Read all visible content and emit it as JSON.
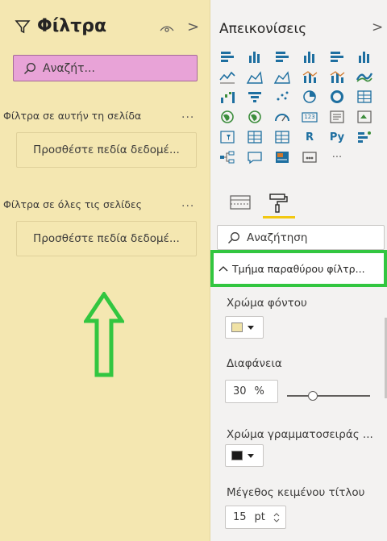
{
  "filters": {
    "title": "Φίλτρα",
    "search_placeholder": "Αναζήτ...",
    "page_section": "Φίλτρα σε αυτήν τη σελίδα",
    "page_dots": "...",
    "page_drop": "Προσθέστε πεδία δεδομέ...",
    "all_section": "Φίλτρα σε όλες τις σελίδες",
    "all_dots": "...",
    "all_drop": "Προσθέστε πεδία δεδομέ..."
  },
  "viz": {
    "title": "Απεικονίσεις",
    "icons": [
      "stacked-bar-chart-icon",
      "stacked-column-chart-icon",
      "clustered-bar-chart-icon",
      "clustered-column-chart-icon",
      "100-percent-bar-chart-icon",
      "100-percent-column-chart-icon",
      "line-chart-icon",
      "area-chart-icon",
      "stacked-area-chart-icon",
      "line-and-column-chart-icon",
      "line-and-clustered-column-chart-icon",
      "ribbon-chart-icon",
      "waterfall-chart-icon",
      "funnel-chart-icon",
      "scatter-chart-icon",
      "pie-chart-icon",
      "donut-chart-icon",
      "treemap-icon",
      "map-icon",
      "filled-map-icon",
      "gauge-icon",
      "card-icon",
      "multi-row-card-icon",
      "kpi-icon",
      "slicer-icon",
      "table-icon",
      "matrix-icon",
      "r-visual-icon",
      "python-visual-icon",
      "key-influencers-icon",
      "decomposition-tree-icon",
      "qa-icon",
      "smart-narrative-icon",
      "paginated-report-icon",
      "more-visuals-icon"
    ],
    "icon_text": {
      "r": "R",
      "py": "Py",
      "more": "···",
      "card": "123"
    },
    "search_placeholder": "Αναζήτηση",
    "section_title": "Τμήμα παραθύρου φίλτρ...",
    "bg_color_label": "Χρώμα φόντου",
    "bg_color": "#f0e2a6",
    "transparency_label": "Διαφάνεια",
    "transparency_value": "30",
    "transparency_unit": "%",
    "transparency_fraction": 0.3,
    "font_color_label": "Χρώμα γραμματοσειράς ...",
    "font_color": "#1b1a19",
    "title_size_label": "Μέγεθος κειμένου τίτλου",
    "title_size_value": "15",
    "title_size_unit": "pt"
  },
  "colors": {
    "filters_bg": "#f4e7b1",
    "search_highlight": "#e8a3d7",
    "highlight_green": "#32c640",
    "accent_yellow": "#f2c811",
    "icon_blue": "#1e6fa0"
  }
}
